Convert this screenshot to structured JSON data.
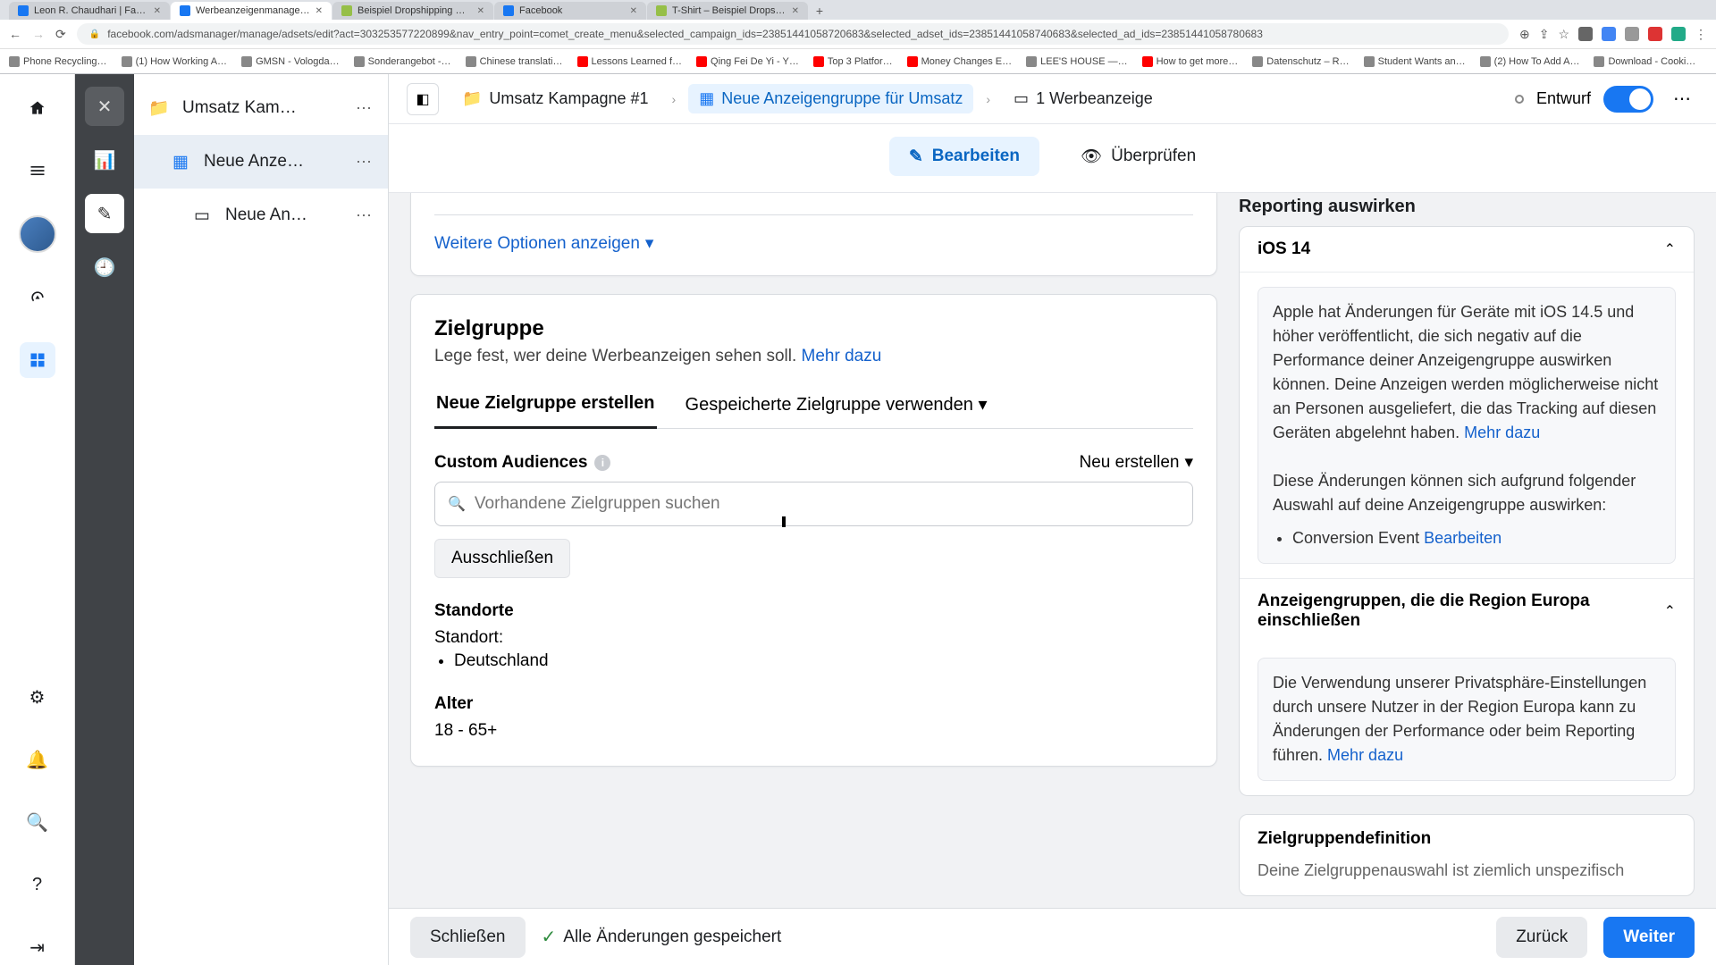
{
  "browser": {
    "tabs": [
      {
        "title": "Leon R. Chaudhari | Facebook",
        "favicon": "fb"
      },
      {
        "title": "Werbeanzeigenmanager – We…",
        "favicon": "fb"
      },
      {
        "title": "Beispiel Dropshipping Store –",
        "favicon": "shopify"
      },
      {
        "title": "Facebook",
        "favicon": "fb"
      },
      {
        "title": "T-Shirt – Beispiel Dropshippi…",
        "favicon": "shopify"
      }
    ],
    "url": "facebook.com/adsmanager/manage/adsets/edit?act=303253577220899&nav_entry_point=comet_create_menu&selected_campaign_ids=23851441058720683&selected_adset_ids=23851441058740683&selected_ad_ids=23851441058780683",
    "bookmarks": [
      "Phone Recycling…",
      "(1) How Working A…",
      "GMSN - Vologda…",
      "Sonderangebot -…",
      "Chinese translati…",
      "Lessons Learned f…",
      "Qing Fei De Yi - Y…",
      "Top 3 Platfor…",
      "Money Changes E…",
      "LEE'S HOUSE —…",
      "How to get more…",
      "Datenschutz – R…",
      "Student Wants an…",
      "(2) How To Add A…",
      "Download - Cooki…"
    ]
  },
  "tree": {
    "items": [
      {
        "label": "Umsatz Kam…"
      },
      {
        "label": "Neue Anze…"
      },
      {
        "label": "Neue An…"
      }
    ]
  },
  "crumbs": {
    "campaign": "Umsatz Kampagne #1",
    "adset": "Neue Anzeigengruppe für Umsatz",
    "ad": "1 Werbeanzeige",
    "status": "Entwurf"
  },
  "tabs": {
    "edit": "Bearbeiten",
    "review": "Überprüfen"
  },
  "main": {
    "more_options": "Weitere Optionen anzeigen",
    "audience_title": "Zielgruppe",
    "audience_sub": "Lege fest, wer deine Werbeanzeigen sehen soll. ",
    "audience_link": "Mehr dazu",
    "tab_create": "Neue Zielgruppe erstellen",
    "tab_saved": "Gespeicherte Zielgruppe verwenden",
    "custom_label": "Custom Audiences",
    "create_new": "Neu erstellen",
    "search_placeholder": "Vorhandene Zielgruppen suchen",
    "exclude": "Ausschließen",
    "locations_label": "Standorte",
    "location_prefix": "Standort:",
    "location_value": "Deutschland",
    "age_label": "Alter",
    "age_value": "18 - 65+"
  },
  "sidebar": {
    "reporting_title": "Reporting auswirken",
    "ios_title": "iOS 14",
    "ios_body1": "Apple hat Änderungen für Geräte mit iOS 14.5 und höher veröffentlicht, die sich negativ auf die Performance deiner Anzeigengruppe auswirken können. Deine Anzeigen werden möglicherweise nicht an Personen ausgeliefert, die das Tracking auf diesen Geräten abgelehnt haben. ",
    "ios_link1": "Mehr dazu",
    "ios_body2": "Diese Änderungen können sich aufgrund folgender Auswahl auf deine Anzeigengruppe auswirken:",
    "ios_bullet": "Conversion Event ",
    "ios_bullet_link": "Bearbeiten",
    "europe_title": "Anzeigengruppen, die die Region Europa einschließen",
    "europe_body": "Die Verwendung unserer Privatsphäre-Einstellungen durch unsere Nutzer in der Region Europa kann zu Änderungen der Performance oder beim Reporting führen. ",
    "europe_link": "Mehr dazu",
    "definition_title": "Zielgruppendefinition",
    "definition_body": "Deine Zielgruppenauswahl ist ziemlich unspezifisch"
  },
  "footer": {
    "close": "Schließen",
    "saved": "Alle Änderungen gespeichert",
    "back": "Zurück",
    "next": "Weiter"
  }
}
